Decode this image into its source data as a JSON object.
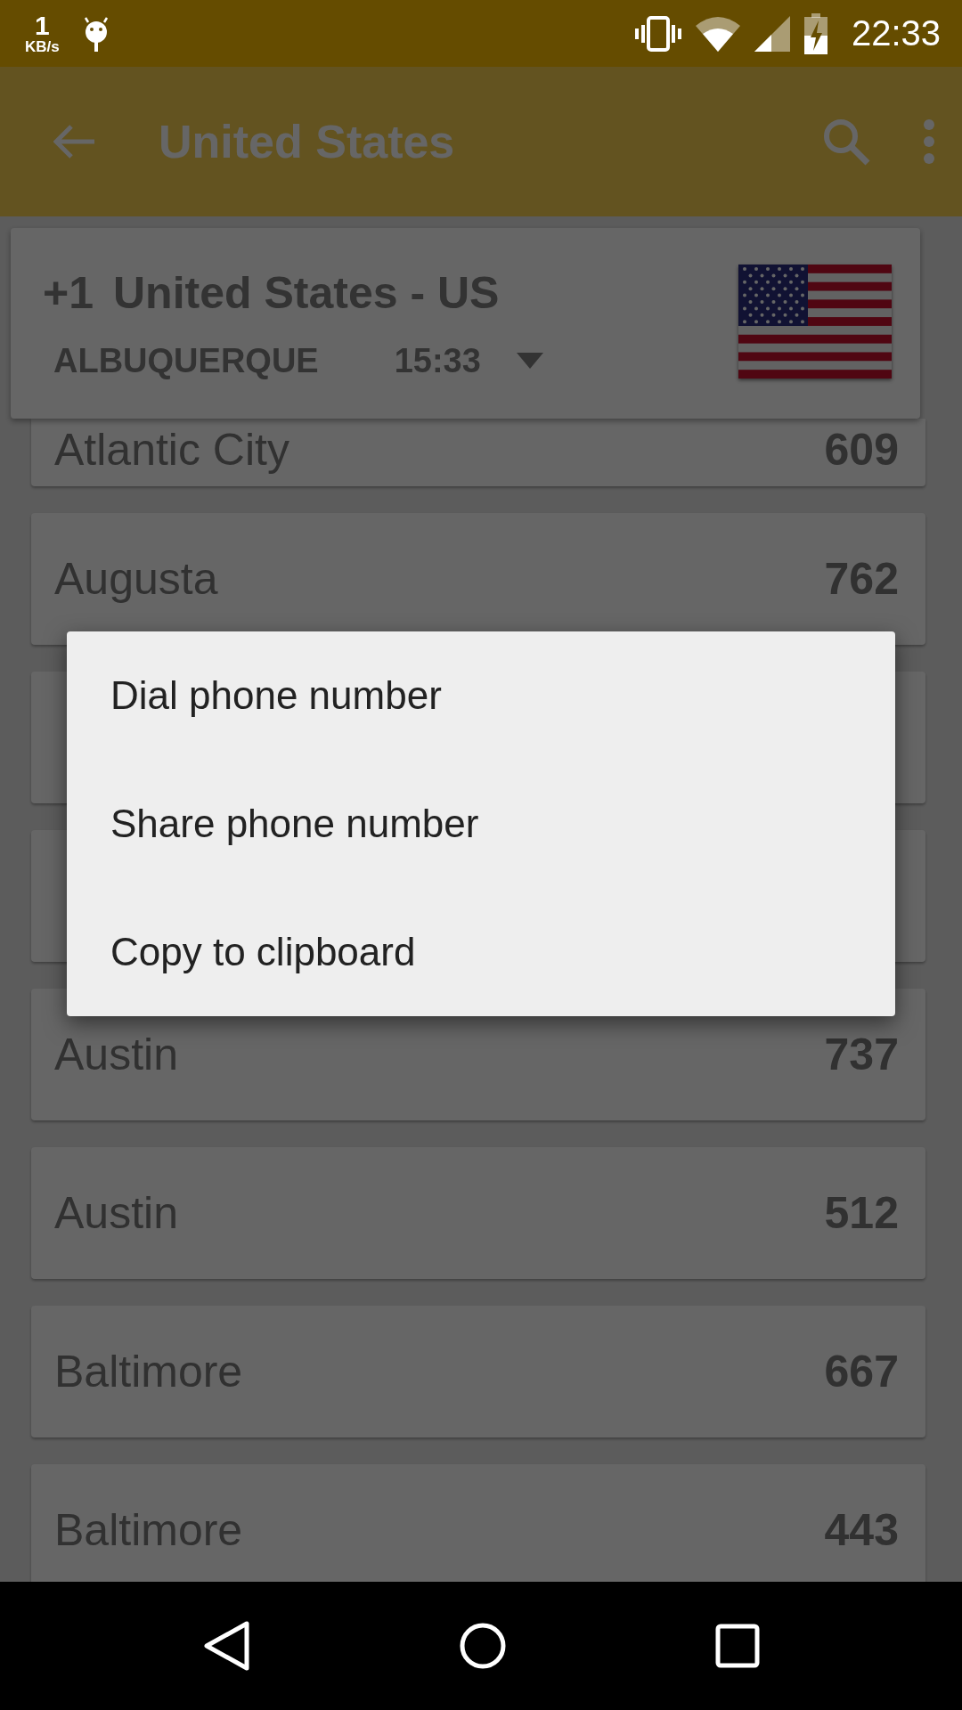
{
  "status_bar": {
    "speed_value": "1",
    "speed_unit": "KB/s",
    "time": "22:33"
  },
  "app_bar": {
    "title": "United States"
  },
  "country_card": {
    "dial_code": "+1",
    "country": "United States - US",
    "city": "ALBUQUERQUE",
    "time": "15:33"
  },
  "list": [
    {
      "kind": "clipped",
      "name": "Atlantic City",
      "code": "609"
    },
    {
      "kind": "row",
      "name": "Augusta",
      "code": "762"
    },
    {
      "kind": "covered"
    },
    {
      "kind": "covered"
    },
    {
      "kind": "row",
      "name": "Austin",
      "code": "737"
    },
    {
      "kind": "row",
      "name": "Austin",
      "code": "512"
    },
    {
      "kind": "row",
      "name": "Baltimore",
      "code": "667"
    },
    {
      "kind": "row",
      "name": "Baltimore",
      "code": "443"
    }
  ],
  "dialog": {
    "items": [
      "Dial phone number",
      "Share phone number",
      "Copy to clipboard"
    ]
  }
}
